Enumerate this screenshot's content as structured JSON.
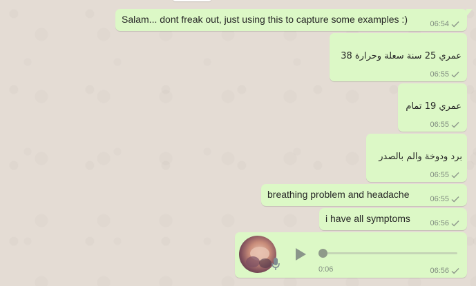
{
  "chat": {
    "messages": [
      {
        "text": "Salam... dont freak out, just using this to capture some examples :)",
        "time": "06:54",
        "status": "sent"
      },
      {
        "text": "عمري 25 سنة سعلة وحرارة 38",
        "time": "06:55",
        "status": "sent"
      },
      {
        "text": "عمري 19 تمام",
        "time": "06:55",
        "status": "sent"
      },
      {
        "text": "برد ودوخة والم بالصدر",
        "time": "06:55",
        "status": "sent"
      },
      {
        "text": "breathing problem and headache",
        "time": "06:55",
        "status": "sent"
      },
      {
        "text": "i have all symptoms",
        "time": "06:56",
        "status": "sent"
      }
    ],
    "voice_note": {
      "duration": "0:06",
      "time": "06:56",
      "status": "sent",
      "progress": 0
    }
  },
  "colors": {
    "outgoing_bubble": "#dcf8c6",
    "wallpaper": "#e5ddd5",
    "meta_text": "#808c80"
  },
  "icons": {
    "check": "single-check-icon",
    "play": "play-icon",
    "mic": "microphone-icon"
  }
}
